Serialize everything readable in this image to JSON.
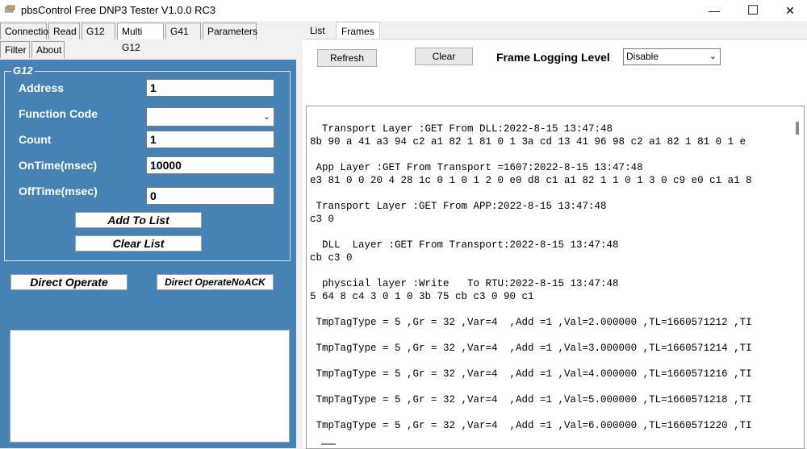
{
  "window": {
    "title": "pbsControl Free DNP3 Tester   V1.0.0 RC3",
    "min_glyph": "—",
    "max_glyph": "☐",
    "close_glyph": "✕"
  },
  "left_tabs_row1": [
    "Connection",
    "Read",
    "G12",
    "Multi G12",
    "G41",
    "Parameters"
  ],
  "left_tabs_row2": [
    "Filter",
    "About"
  ],
  "group": {
    "legend": "G12",
    "address_label": "Address",
    "address_value": "1",
    "function_code_label": "Function Code",
    "function_code_value": "",
    "count_label": "Count",
    "count_value": "1",
    "ontime_label": "OnTime(msec)",
    "ontime_value": "10000",
    "offtime_label": "OffTime(msec)",
    "offtime_value": "0",
    "add_to_list": "Add To List",
    "clear_list": "Clear List"
  },
  "buttons": {
    "direct_operate": "Direct  Operate",
    "direct_operate_noack": "Direct  OperateNoACK"
  },
  "right_tabs": [
    "List",
    "Frames"
  ],
  "frames": {
    "refresh": "Refresh",
    "clear": "Clear",
    "logging_label": "Frame Logging Level",
    "logging_value": "Disable",
    "log_lines": [
      "  Transport Layer :GET From DLL:2022-8-15 13:47:48",
      "8b 90 a 41 a3 94 c2 a1 82 1 81 0 1 3a cd 13 41 96 98 c2 a1 82 1 81 0 1 e",
      "",
      " App Layer :GET From Transport =1607:2022-8-15 13:47:48",
      "e3 81 0 0 20 4 28 1c 0 1 0 1 2 0 e0 d8 c1 a1 82 1 1 0 1 3 0 c9 e0 c1 a1 8",
      "",
      " Transport Layer :GET From APP:2022-8-15 13:47:48",
      "c3 0",
      "",
      "  DLL  Layer :GET From Transport:2022-8-15 13:47:48",
      "cb c3 0",
      "",
      "  physcial layer :Write   To RTU:2022-8-15 13:47:48",
      "5 64 8 c4 3 0 1 0 3b 75 cb c3 0 90 c1",
      "",
      " TmpTagType = 5 ,Gr = 32 ,Var=4  ,Add =1 ,Val=2.000000 ,TL=1660571212 ,TI",
      "",
      " TmpTagType = 5 ,Gr = 32 ,Var=4  ,Add =1 ,Val=3.000000 ,TL=1660571214 ,TI",
      "",
      " TmpTagType = 5 ,Gr = 32 ,Var=4  ,Add =1 ,Val=4.000000 ,TL=1660571216 ,TI",
      "",
      " TmpTagType = 5 ,Gr = 32 ,Var=4  ,Add =1 ,Val=5.000000 ,TL=1660571218 ,TI",
      "",
      " TmpTagType = 5 ,Gr = 32 ,Var=4  ,Add =1 ,Val=6.000000 ,TL=1660571220 ,TI"
    ]
  }
}
